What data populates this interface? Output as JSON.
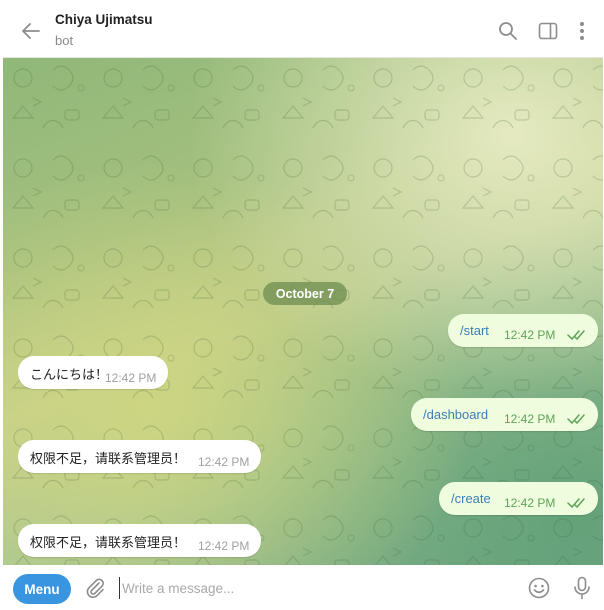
{
  "header": {
    "title": "Chiya Ujimatsu",
    "subtitle": "bot",
    "icons": [
      "back-arrow-icon",
      "search-icon",
      "sidebar-toggle-icon",
      "more-vertical-icon"
    ]
  },
  "chat": {
    "date_separator": "October 7",
    "messages": [
      {
        "direction": "outgoing",
        "text": "/start",
        "time": "12:42 PM",
        "status": "read"
      },
      {
        "direction": "incoming",
        "text": "こんにちは！",
        "time": "12:42 PM"
      },
      {
        "direction": "outgoing",
        "text": "/dashboard",
        "time": "12:42 PM",
        "status": "read"
      },
      {
        "direction": "incoming",
        "text": "权限不足，请联系管理员！",
        "time": "12:42 PM"
      },
      {
        "direction": "outgoing",
        "text": "/create",
        "time": "12:42 PM",
        "status": "read"
      },
      {
        "direction": "incoming",
        "text": "权限不足，请联系管理员！",
        "time": "12:42 PM"
      }
    ]
  },
  "composer": {
    "menu_label": "Menu",
    "placeholder": "Write a message...",
    "value": "",
    "icons": [
      "attach-icon",
      "emoji-icon",
      "microphone-icon"
    ]
  },
  "colors": {
    "accent": "#3a95e0",
    "outgoing_bubble": "#effdde",
    "incoming_bubble": "#ffffff",
    "outgoing_text": "#3a7fb8",
    "read_ticks": "#5ea35a",
    "date_pill": "#6e8c50"
  }
}
